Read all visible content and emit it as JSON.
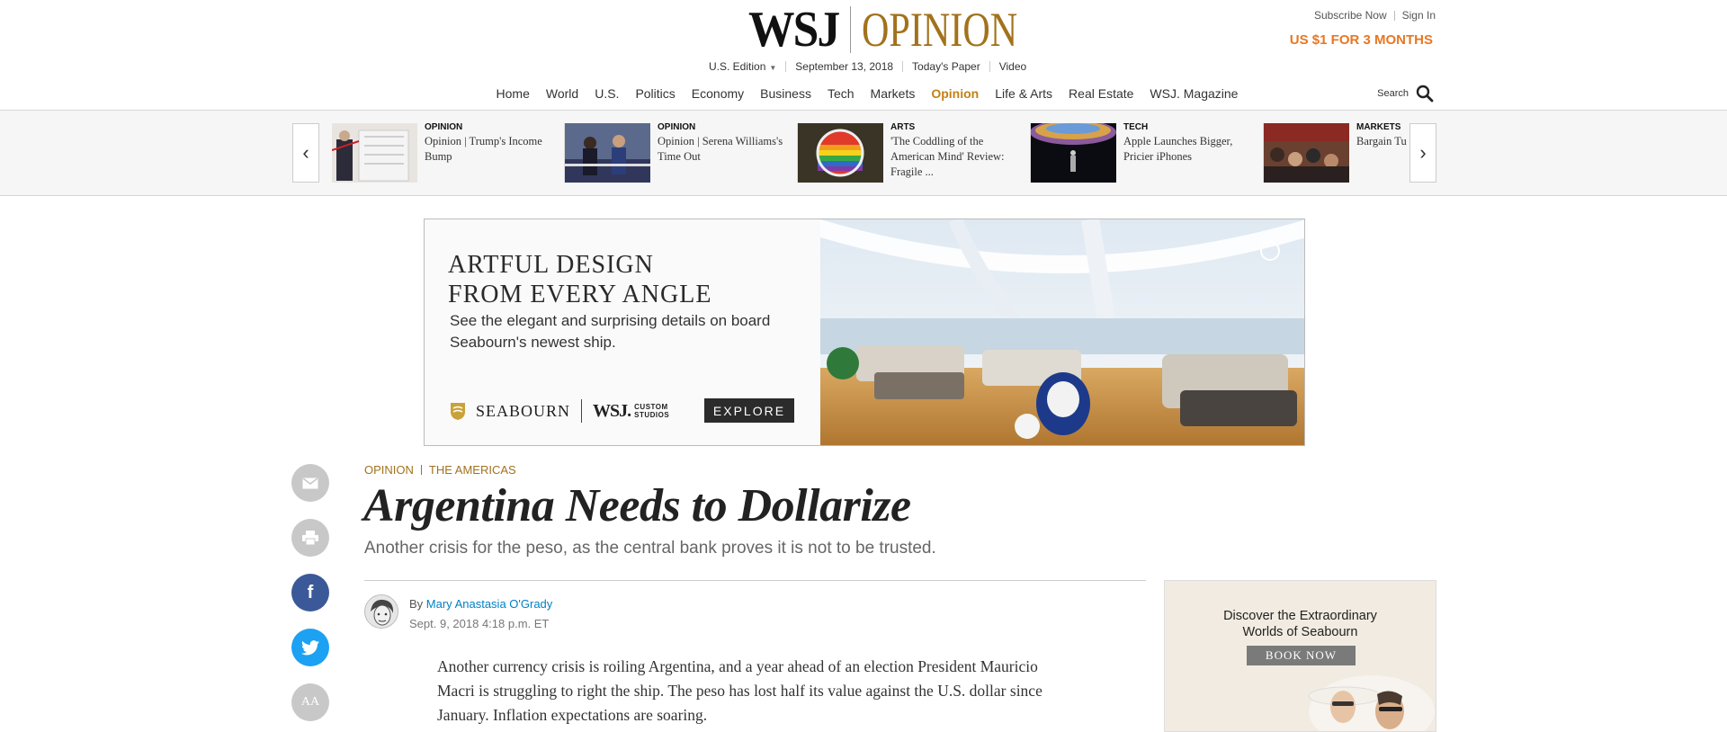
{
  "header": {
    "logo_left": "WSJ",
    "logo_right": "OPINION",
    "edition": "U.S. Edition",
    "date": "September 13, 2018",
    "todays_paper": "Today's Paper",
    "video": "Video",
    "subscribe": "Subscribe Now",
    "sign_in": "Sign In",
    "promo": "US $1 FOR 3 MONTHS",
    "search_label": "Search",
    "brand_gold": "#a2721c",
    "promo_orange": "#e87722"
  },
  "nav": {
    "items": [
      "Home",
      "World",
      "U.S.",
      "Politics",
      "Economy",
      "Business",
      "Tech",
      "Markets",
      "Opinion",
      "Life & Arts",
      "Real Estate",
      "WSJ. Magazine"
    ],
    "active": "Opinion"
  },
  "carousel": {
    "cards": [
      {
        "category": "OPINION",
        "title": "Opinion | Trump's Income Bump"
      },
      {
        "category": "OPINION",
        "title": "Opinion | Serena Williams's Time Out"
      },
      {
        "category": "ARTS",
        "title": "'The Coddling of the American Mind' Review: Fragile ..."
      },
      {
        "category": "TECH",
        "title": "Apple Launches Bigger, Pricier iPhones"
      },
      {
        "category": "MARKETS",
        "title": "Bargain Turkey, Struggle"
      }
    ]
  },
  "ad": {
    "headline_line1": "ARTFUL DESIGN",
    "headline_line2": "FROM EVERY ANGLE",
    "subtext": "See the elegant and surprising details on board Seabourn's newest ship.",
    "brand": "SEABOURN",
    "wsj": "WSJ.",
    "custom": "CUSTOM",
    "studios": "STUDIOS",
    "cta": "EXPLORE"
  },
  "article": {
    "flag_section": "OPINION",
    "flag_subsection": "THE AMERICAS",
    "headline": "Argentina Needs to Dollarize",
    "dek": "Another crisis for the peso, as the central bank proves it is not to be trusted.",
    "by": "By",
    "author": "Mary Anastasia O'Grady",
    "timestamp": "Sept. 9, 2018 4:18 p.m. ET",
    "body": "Another currency crisis is roiling Argentina, and a year ahead of an election President Mauricio Macri is struggling to right the ship. The peso has lost half its value against the U.S. dollar since January. Inflation expectations are soaring."
  },
  "share": {
    "font_size_label": "AA"
  },
  "side_ad": {
    "line1": "Discover the Extraordinary",
    "line2": "Worlds of Seabourn",
    "cta": "BOOK NOW"
  }
}
